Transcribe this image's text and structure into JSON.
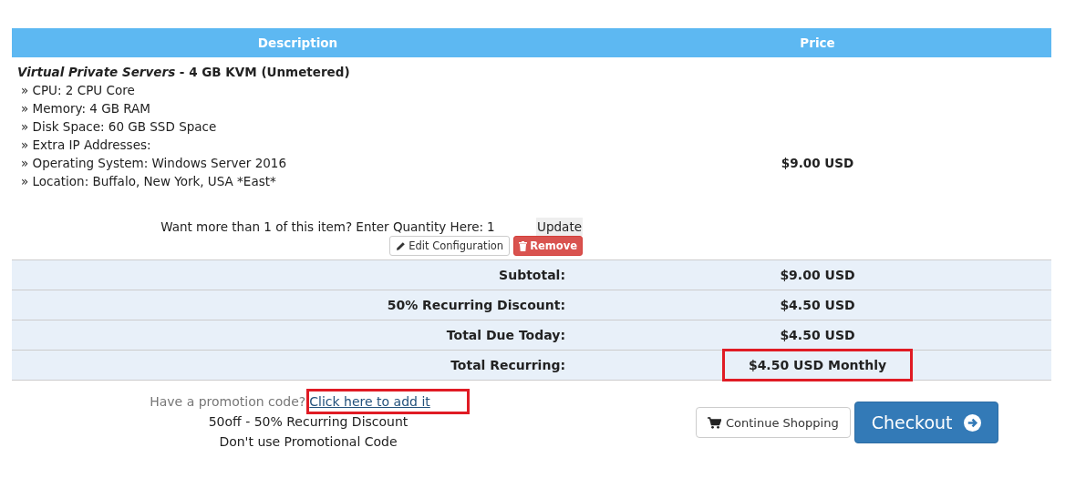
{
  "table": {
    "columns": [
      "Description",
      "Price"
    ],
    "item": {
      "title": "*Virtual Private Servers* - 4 GB KVM (Unmetered)",
      "options": [
        "» CPU: 2 CPU Core",
        "» Memory: 4 GB RAM",
        "» Disk Space: 60 GB SSD Space",
        "» Extra IP Addresses:",
        "» Operating System: Windows Server 2016",
        "» Location: Buffalo, New York, USA *East*"
      ],
      "price": "$9.00 USD",
      "quantity_label": "Want more than 1 of this item? Enter Quantity Here:",
      "quantity": "1",
      "update_button": "Update",
      "edit_button": "Edit Configuration",
      "remove_button": "Remove"
    },
    "totals": [
      {
        "label": "Subtotal:",
        "value": "$9.00 USD",
        "highlighted": false
      },
      {
        "label": "50% Recurring Discount:",
        "value": "$4.50 USD",
        "highlighted": false
      },
      {
        "label": "Total Due Today:",
        "value": "$4.50 USD",
        "highlighted": false
      },
      {
        "label": "Total Recurring:",
        "value": "$4.50 USD Monthly",
        "highlighted": true
      }
    ]
  },
  "promo": {
    "prompt": "Have a promotion code?",
    "link": "Click here to add it",
    "link_highlighted": true,
    "applied": "50off - 50% Recurring Discount",
    "remove": "Don't use Promotional Code"
  },
  "buttons": {
    "continue": "Continue Shopping",
    "checkout": "Checkout"
  }
}
